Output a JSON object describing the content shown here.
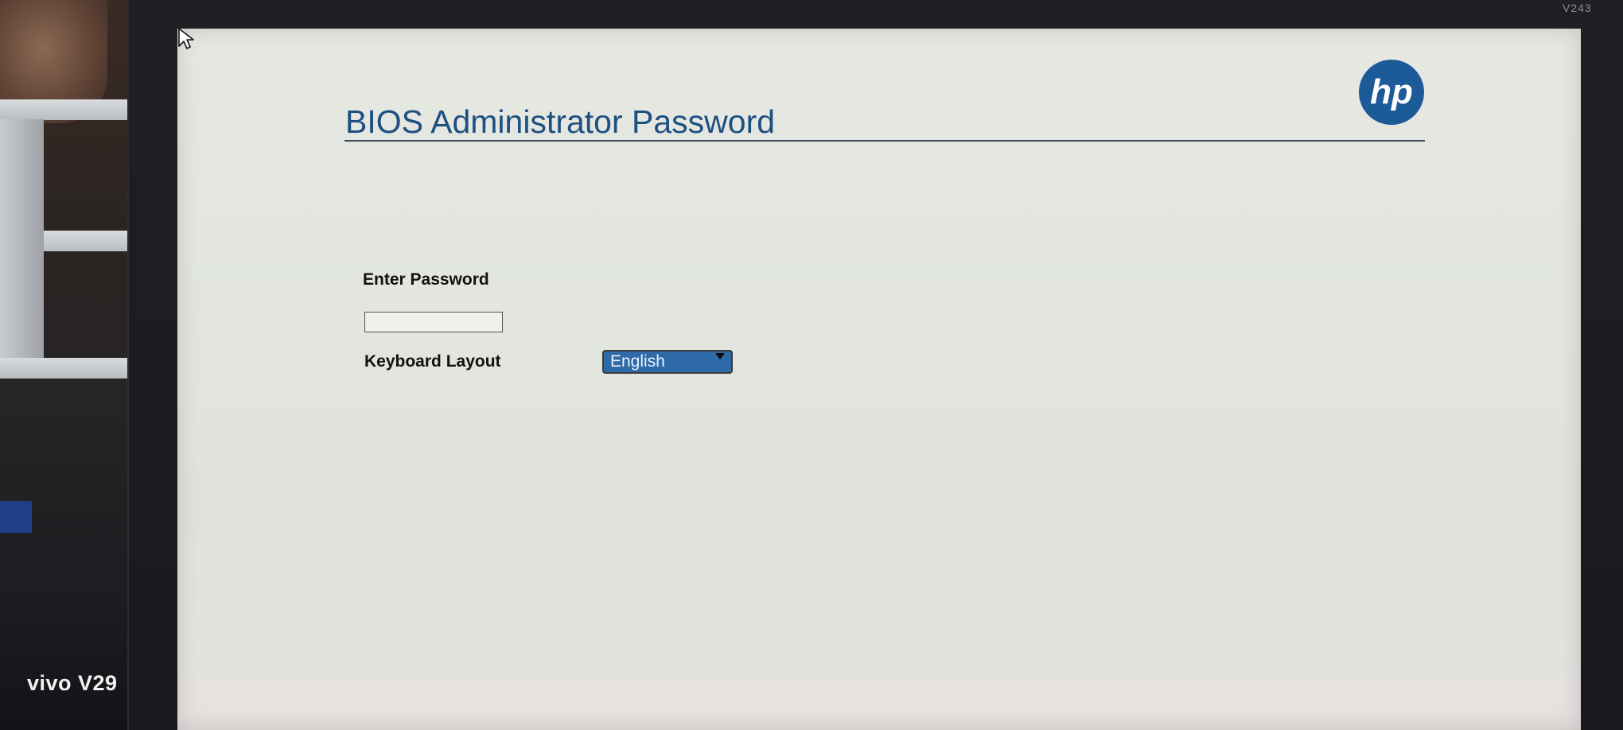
{
  "bios": {
    "title": "BIOS Administrator Password",
    "logo_text": "hp",
    "password": {
      "label": "Enter Password",
      "value": ""
    },
    "keyboard_layout": {
      "label": "Keyboard Layout",
      "selected": "English"
    }
  },
  "monitor": {
    "brand_label": "V243"
  },
  "camera_watermark": "vivo V29",
  "colors": {
    "title": "#1d4f80",
    "hp_logo": "#1c5a98",
    "select_highlight": "#2e6aa8",
    "screen_background": "#e3e6df"
  },
  "icons": {
    "logo": "hp-logo-icon",
    "cursor": "mouse-pointer-icon",
    "dropdown": "dropdown-arrow-icon"
  }
}
